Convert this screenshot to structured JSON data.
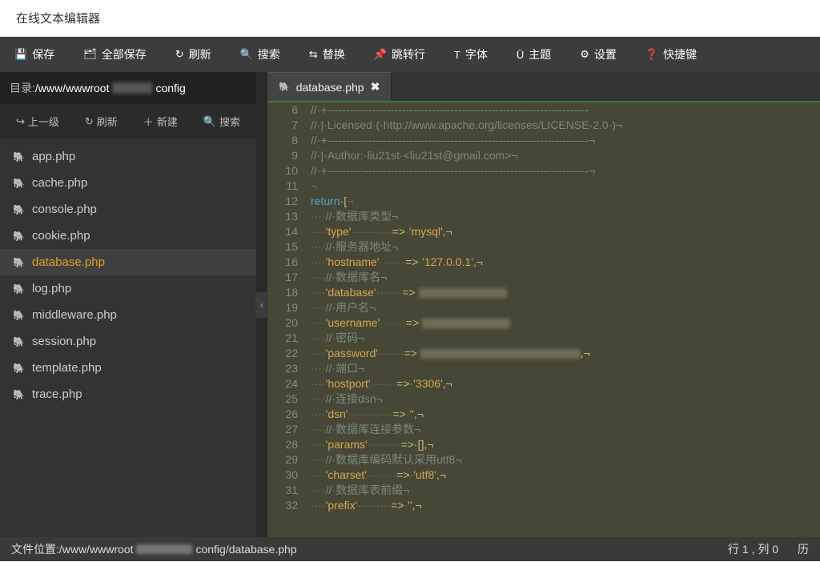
{
  "title": "在线文本编辑器",
  "toolbar": [
    {
      "name": "save-button",
      "icon": "💾",
      "label": "保存"
    },
    {
      "name": "save-all-button",
      "icon": "🗂",
      "label": "全部保存"
    },
    {
      "name": "refresh-button",
      "icon": "↻",
      "label": "刷新"
    },
    {
      "name": "search-button",
      "icon": "🔍",
      "label": "搜索"
    },
    {
      "name": "replace-button",
      "icon": "⇆",
      "label": "替换"
    },
    {
      "name": "goto-button",
      "icon": "📌",
      "label": "跳转行"
    },
    {
      "name": "font-button",
      "icon": "T",
      "label": "字体"
    },
    {
      "name": "theme-button",
      "icon": "Ü",
      "label": "主题"
    },
    {
      "name": "settings-button",
      "icon": "⚙",
      "label": "设置"
    },
    {
      "name": "shortcuts-button",
      "icon": "❓",
      "label": "快捷键"
    }
  ],
  "dir": {
    "label": "目录:",
    "path_prefix": " /www/wwwroot",
    "path_suffix": "config"
  },
  "side_tools": {
    "up": "上一级",
    "refresh": "刷新",
    "new": "新建",
    "search": "搜索",
    "up_icon": "↪",
    "refresh_icon": "↻",
    "new_icon": "＋",
    "search_icon": "🔍"
  },
  "files": [
    {
      "name": "app.php",
      "active": false
    },
    {
      "name": "cache.php",
      "active": false
    },
    {
      "name": "console.php",
      "active": false
    },
    {
      "name": "cookie.php",
      "active": false
    },
    {
      "name": "database.php",
      "active": true
    },
    {
      "name": "log.php",
      "active": false
    },
    {
      "name": "middleware.php",
      "active": false
    },
    {
      "name": "session.php",
      "active": false
    },
    {
      "name": "template.php",
      "active": false
    },
    {
      "name": "trace.php",
      "active": false
    }
  ],
  "tab": {
    "label": "database.php",
    "close": "✖"
  },
  "code": [
    {
      "n": "6",
      "t": "//·+----------------------------------------------------------------------",
      "cls": "c-cmt"
    },
    {
      "n": "7",
      "t": "//·|·Licensed·(·http://www.apache.org/licenses/LICENSE-2.0·)¬",
      "cls": "c-cmt"
    },
    {
      "n": "8",
      "t": "//·+----------------------------------------------------------------------¬",
      "cls": "c-cmt"
    },
    {
      "n": "9",
      "t": "//·|·Author:·liu21st·<liu21st@gmail.com>¬",
      "cls": "c-cmt"
    },
    {
      "n": "10",
      "t": "//·+----------------------------------------------------------------------¬",
      "cls": "c-cmt"
    },
    {
      "n": "11",
      "t": "¬",
      "cls": "c-ws"
    },
    {
      "n": "12",
      "raw": [
        {
          "t": "return",
          "c": "c-kw"
        },
        {
          "t": "·[",
          "c": "c-punc"
        },
        {
          "t": "¬",
          "c": "c-ws"
        }
      ]
    },
    {
      "n": "13",
      "raw": [
        {
          "t": "····",
          "c": "c-ws"
        },
        {
          "t": "//·数据库类型¬",
          "c": "c-cmt"
        }
      ]
    },
    {
      "n": "14",
      "raw": [
        {
          "t": "····",
          "c": "c-ws"
        },
        {
          "t": "'type'",
          "c": "c-str"
        },
        {
          "t": "···········",
          "c": "c-ws"
        },
        {
          "t": "=>",
          "c": "c-punc"
        },
        {
          "t": "·",
          "c": "c-ws"
        },
        {
          "t": "'mysql'",
          "c": "c-str"
        },
        {
          "t": ",¬",
          "c": "c-punc"
        }
      ]
    },
    {
      "n": "15",
      "raw": [
        {
          "t": "····",
          "c": "c-ws"
        },
        {
          "t": "//·服务器地址¬",
          "c": "c-cmt"
        }
      ]
    },
    {
      "n": "16",
      "raw": [
        {
          "t": "····",
          "c": "c-ws"
        },
        {
          "t": "'hostname'",
          "c": "c-str"
        },
        {
          "t": "·······",
          "c": "c-ws"
        },
        {
          "t": "=>",
          "c": "c-punc"
        },
        {
          "t": "·",
          "c": "c-ws"
        },
        {
          "t": "'127.0.0.1'",
          "c": "c-str"
        },
        {
          "t": ",¬",
          "c": "c-punc"
        }
      ]
    },
    {
      "n": "17",
      "raw": [
        {
          "t": "····",
          "c": "c-ws"
        },
        {
          "t": "//·数据库名¬",
          "c": "c-cmt"
        }
      ]
    },
    {
      "n": "18",
      "raw": [
        {
          "t": "····",
          "c": "c-ws"
        },
        {
          "t": "'database'",
          "c": "c-str"
        },
        {
          "t": "·······",
          "c": "c-ws"
        },
        {
          "t": "=>",
          "c": "c-punc"
        },
        {
          "t": " ",
          "c": "c-ws"
        },
        {
          "blur": true
        }
      ]
    },
    {
      "n": "19",
      "raw": [
        {
          "t": "····",
          "c": "c-ws"
        },
        {
          "t": "//·用户名¬",
          "c": "c-cmt"
        }
      ]
    },
    {
      "n": "20",
      "raw": [
        {
          "t": "····",
          "c": "c-ws"
        },
        {
          "t": "'username'",
          "c": "c-str"
        },
        {
          "t": "·······",
          "c": "c-ws"
        },
        {
          "t": "=>",
          "c": "c-punc"
        },
        {
          "t": " ",
          "c": "c-ws"
        },
        {
          "blur": true
        }
      ]
    },
    {
      "n": "21",
      "raw": [
        {
          "t": "····",
          "c": "c-ws"
        },
        {
          "t": "//·密码¬",
          "c": "c-cmt"
        }
      ]
    },
    {
      "n": "22",
      "raw": [
        {
          "t": "····",
          "c": "c-ws"
        },
        {
          "t": "'password'",
          "c": "c-str"
        },
        {
          "t": "·······",
          "c": "c-ws"
        },
        {
          "t": "=>",
          "c": "c-punc"
        },
        {
          "t": " ",
          "c": "c-ws"
        },
        {
          "blur": true,
          "wide": true
        },
        {
          "t": ",¬",
          "c": "c-punc"
        }
      ]
    },
    {
      "n": "23",
      "raw": [
        {
          "t": "····",
          "c": "c-ws"
        },
        {
          "t": "//·端口¬",
          "c": "c-cmt"
        }
      ]
    },
    {
      "n": "24",
      "raw": [
        {
          "t": "····",
          "c": "c-ws"
        },
        {
          "t": "'hostport'",
          "c": "c-str"
        },
        {
          "t": "·······",
          "c": "c-ws"
        },
        {
          "t": "=>",
          "c": "c-punc"
        },
        {
          "t": "·",
          "c": "c-ws"
        },
        {
          "t": "'3306'",
          "c": "c-str"
        },
        {
          "t": ",¬",
          "c": "c-punc"
        }
      ]
    },
    {
      "n": "25",
      "raw": [
        {
          "t": "····",
          "c": "c-ws"
        },
        {
          "t": "//·连接dsn¬",
          "c": "c-cmt"
        }
      ]
    },
    {
      "n": "26",
      "raw": [
        {
          "t": "····",
          "c": "c-ws"
        },
        {
          "t": "'dsn'",
          "c": "c-str"
        },
        {
          "t": "············",
          "c": "c-ws"
        },
        {
          "t": "=>",
          "c": "c-punc"
        },
        {
          "t": "·",
          "c": "c-ws"
        },
        {
          "t": "''",
          "c": "c-str"
        },
        {
          "t": ",¬",
          "c": "c-punc"
        }
      ]
    },
    {
      "n": "27",
      "raw": [
        {
          "t": "····",
          "c": "c-ws"
        },
        {
          "t": "//·数据库连接参数¬",
          "c": "c-cmt"
        }
      ]
    },
    {
      "n": "28",
      "raw": [
        {
          "t": "····",
          "c": "c-ws"
        },
        {
          "t": "'params'",
          "c": "c-str"
        },
        {
          "t": "·········",
          "c": "c-ws"
        },
        {
          "t": "=>",
          "c": "c-punc"
        },
        {
          "t": "·[],¬",
          "c": "c-punc"
        }
      ]
    },
    {
      "n": "29",
      "raw": [
        {
          "t": "····",
          "c": "c-ws"
        },
        {
          "t": "//·数据库编码默认采用utf8¬",
          "c": "c-cmt"
        }
      ]
    },
    {
      "n": "30",
      "raw": [
        {
          "t": "····",
          "c": "c-ws"
        },
        {
          "t": "'charset'",
          "c": "c-str"
        },
        {
          "t": "········",
          "c": "c-ws"
        },
        {
          "t": "=>",
          "c": "c-punc"
        },
        {
          "t": "·",
          "c": "c-ws"
        },
        {
          "t": "'utf8'",
          "c": "c-str"
        },
        {
          "t": ",¬",
          "c": "c-punc"
        }
      ]
    },
    {
      "n": "31",
      "raw": [
        {
          "t": "····",
          "c": "c-ws"
        },
        {
          "t": "//·数据库表前缀¬",
          "c": "c-cmt"
        }
      ]
    },
    {
      "n": "32",
      "raw": [
        {
          "t": "····",
          "c": "c-ws"
        },
        {
          "t": "'prefix'",
          "c": "c-str"
        },
        {
          "t": "·········",
          "c": "c-ws"
        },
        {
          "t": "=>",
          "c": "c-punc"
        },
        {
          "t": "·",
          "c": "c-ws"
        },
        {
          "t": "''",
          "c": "c-str"
        },
        {
          "t": ",¬",
          "c": "c-punc"
        }
      ]
    }
  ],
  "status": {
    "label": "文件位置:",
    "path_prefix": " /www/wwwroot",
    "path_suffix": "config/database.php",
    "rowcol": "行 1 , 列 0",
    "history": "历"
  }
}
